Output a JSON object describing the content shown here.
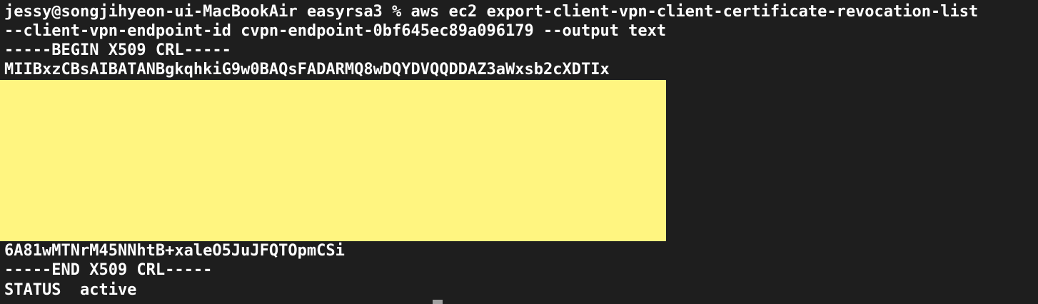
{
  "terminal": {
    "prompt_command_line": "jessy@songjihyeon-ui-MacBookAir easyrsa3 % aws ec2 export-client-vpn-client-certificate-revocation-list",
    "command_continuation": "--client-vpn-endpoint-id cvpn-endpoint-0bf645ec89a096179 --output text",
    "crl_begin": "-----BEGIN X509 CRL-----",
    "crl_first_line": "MIIBxzCBsAIBATANBgkqhkiG9w0BAQsFADARMQ8wDQYDVQQDDAZ3aWxsb2cXDTIx",
    "crl_last_line": "6A81wMTNrM45NNhtB+xaleO5JuJFQTOpmCSi",
    "crl_end": "-----END X509 CRL-----",
    "status_line": "STATUS  active"
  },
  "colors": {
    "background": "#1e1e1e",
    "text": "#ffffff",
    "redaction_highlight": "#fff580"
  }
}
